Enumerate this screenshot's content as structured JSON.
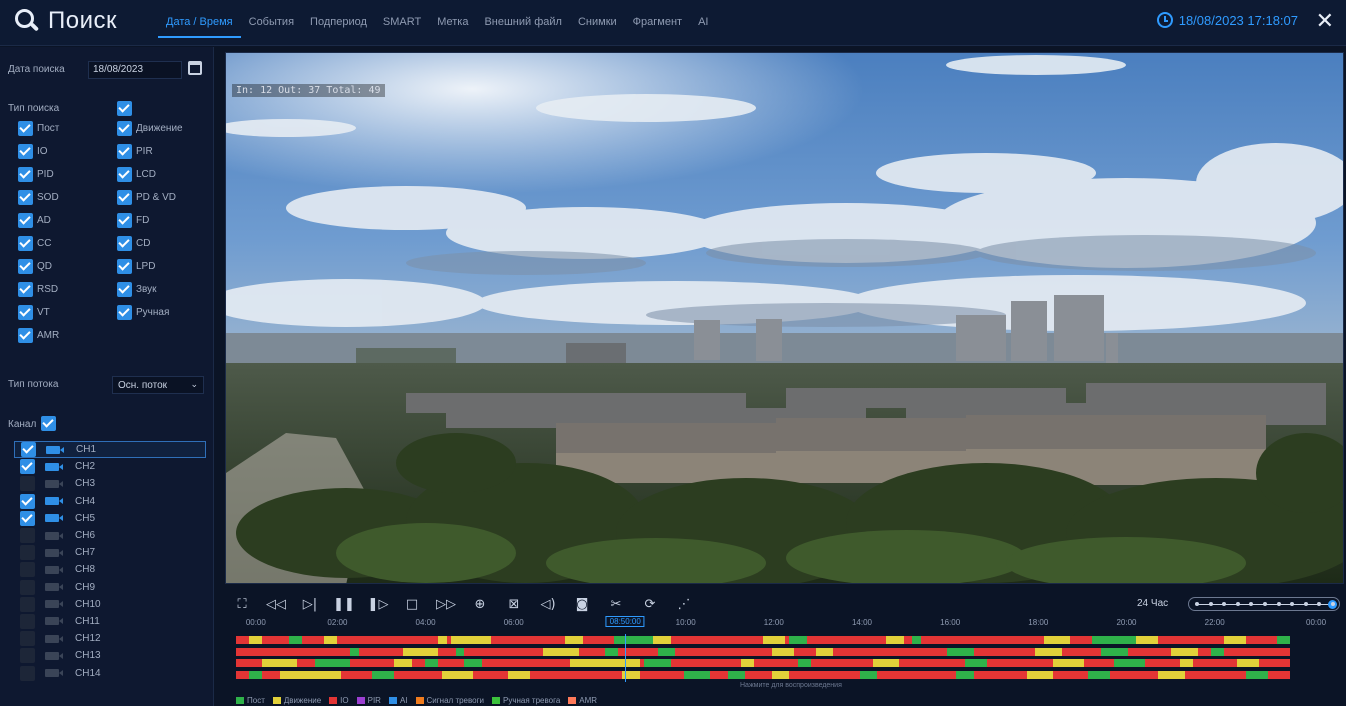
{
  "header": {
    "title": "Поиск",
    "tabs": [
      {
        "label": "Дата / Время",
        "active": true
      },
      {
        "label": "События",
        "active": false
      },
      {
        "label": "Подпериод",
        "active": false
      },
      {
        "label": "SMART",
        "active": false
      },
      {
        "label": "Метка",
        "active": false
      },
      {
        "label": "Внешний файл",
        "active": false
      },
      {
        "label": "Снимки",
        "active": false
      },
      {
        "label": "Фрагмент",
        "active": false
      },
      {
        "label": "AI",
        "active": false
      }
    ],
    "datetime": "18/08/2023 17:18:07",
    "accent_color": "#2f9bff"
  },
  "sidebar": {
    "search_date_label": "Дата поиска",
    "search_date_value": "18/08/2023",
    "search_type_label": "Тип поиска",
    "search_type_all": true,
    "types": [
      {
        "label": "Пост",
        "checked": true
      },
      {
        "label": "Движение",
        "checked": true
      },
      {
        "label": "IO",
        "checked": true
      },
      {
        "label": "PIR",
        "checked": true
      },
      {
        "label": "PID",
        "checked": true
      },
      {
        "label": "LCD",
        "checked": true
      },
      {
        "label": "SOD",
        "checked": true
      },
      {
        "label": "PD & VD",
        "checked": true
      },
      {
        "label": "AD",
        "checked": true
      },
      {
        "label": "FD",
        "checked": true
      },
      {
        "label": "CC",
        "checked": true
      },
      {
        "label": "CD",
        "checked": true
      },
      {
        "label": "QD",
        "checked": true
      },
      {
        "label": "LPD",
        "checked": true
      },
      {
        "label": "RSD",
        "checked": true
      },
      {
        "label": "Звук",
        "checked": true
      },
      {
        "label": "VT",
        "checked": true
      },
      {
        "label": "Ручная",
        "checked": true
      },
      {
        "label": "AMR",
        "checked": true
      }
    ],
    "stream_type_label": "Тип потока",
    "stream_type_value": "Осн. поток",
    "channels_label": "Канал",
    "channels_all": true,
    "channels": [
      {
        "label": "CH1",
        "checked": true,
        "active": true,
        "selected": true
      },
      {
        "label": "CH2",
        "checked": true,
        "active": true,
        "selected": false
      },
      {
        "label": "CH3",
        "checked": false,
        "active": false,
        "selected": false
      },
      {
        "label": "CH4",
        "checked": true,
        "active": true,
        "selected": false
      },
      {
        "label": "CH5",
        "checked": true,
        "active": true,
        "selected": false
      },
      {
        "label": "CH6",
        "checked": false,
        "active": false,
        "selected": false
      },
      {
        "label": "CH7",
        "checked": false,
        "active": false,
        "selected": false
      },
      {
        "label": "CH8",
        "checked": false,
        "active": false,
        "selected": false
      },
      {
        "label": "CH9",
        "checked": false,
        "active": false,
        "selected": false
      },
      {
        "label": "CH10",
        "checked": false,
        "active": false,
        "selected": false
      },
      {
        "label": "CH11",
        "checked": false,
        "active": false,
        "selected": false
      },
      {
        "label": "CH12",
        "checked": false,
        "active": false,
        "selected": false
      },
      {
        "label": "CH13",
        "checked": false,
        "active": false,
        "selected": false
      },
      {
        "label": "CH14",
        "checked": false,
        "active": false,
        "selected": false
      }
    ]
  },
  "video": {
    "osd_text": "In: 12  Out: 37  Total: 49"
  },
  "controls": [
    {
      "name": "fullscreen-icon",
      "glyph": "⛶"
    },
    {
      "name": "rewind-icon",
      "glyph": "◁◁"
    },
    {
      "name": "slow-play-icon",
      "glyph": "▷|"
    },
    {
      "name": "pause-icon",
      "glyph": "❚❚"
    },
    {
      "name": "frame-step-icon",
      "glyph": "❚▷"
    },
    {
      "name": "stop-icon",
      "glyph": "□"
    },
    {
      "name": "fast-forward-icon",
      "glyph": "▷▷"
    },
    {
      "name": "zoom-icon",
      "glyph": "⊕"
    },
    {
      "name": "split-screen-icon",
      "glyph": "⊠"
    },
    {
      "name": "volume-icon",
      "glyph": "◁)"
    },
    {
      "name": "snapshot-icon",
      "glyph": "◙"
    },
    {
      "name": "clip-icon",
      "glyph": "✂"
    },
    {
      "name": "save-icon",
      "glyph": "⟳"
    },
    {
      "name": "tag-icon",
      "glyph": "⋰"
    }
  ],
  "zoom": {
    "label": "24 Час",
    "level": 1.0
  },
  "timeline": {
    "ticks": [
      "00:00",
      "02:00",
      "04:00",
      "06:00",
      "10:00",
      "12:00",
      "14:00",
      "16:00",
      "18:00",
      "20:00",
      "22:00",
      "00:00"
    ],
    "cursor_time": "08:50:00",
    "cursor_hour": 8.83,
    "hint": "Нажмите для воспроизведения",
    "tracks": [
      {
        "channel": "CH1",
        "segments": [
          [
            0.3,
            0.6,
            "yellow"
          ],
          [
            1.2,
            1.5,
            "green"
          ],
          [
            2.0,
            2.3,
            "yellow"
          ],
          [
            4.6,
            4.8,
            "yellow"
          ],
          [
            4.9,
            5.8,
            "yellow"
          ],
          [
            7.5,
            7.9,
            "yellow"
          ],
          [
            8.6,
            9.5,
            "green"
          ],
          [
            9.5,
            9.9,
            "yellow"
          ],
          [
            12.0,
            12.5,
            "yellow"
          ],
          [
            12.6,
            13.0,
            "green"
          ],
          [
            14.8,
            15.2,
            "yellow"
          ],
          [
            15.4,
            15.6,
            "green"
          ],
          [
            18.4,
            19.0,
            "yellow"
          ],
          [
            19.5,
            20.5,
            "green"
          ],
          [
            20.5,
            21.0,
            "yellow"
          ],
          [
            22.5,
            23.0,
            "yellow"
          ],
          [
            23.7,
            24.0,
            "green"
          ]
        ]
      },
      {
        "channel": "CH2",
        "segments": [
          [
            2.6,
            2.8,
            "green"
          ],
          [
            3.8,
            4.6,
            "yellow"
          ],
          [
            5.0,
            5.2,
            "green"
          ],
          [
            7.0,
            7.8,
            "yellow"
          ],
          [
            8.4,
            8.7,
            "green"
          ],
          [
            9.6,
            10.0,
            "green"
          ],
          [
            12.2,
            12.7,
            "yellow"
          ],
          [
            13.2,
            13.6,
            "yellow"
          ],
          [
            16.2,
            16.8,
            "green"
          ],
          [
            18.2,
            18.8,
            "yellow"
          ],
          [
            19.7,
            20.3,
            "green"
          ],
          [
            21.3,
            21.9,
            "yellow"
          ],
          [
            22.2,
            22.5,
            "green"
          ]
        ]
      },
      {
        "channel": "CH4",
        "segments": [
          [
            0.6,
            1.4,
            "yellow"
          ],
          [
            1.8,
            2.6,
            "green"
          ],
          [
            3.6,
            4.0,
            "yellow"
          ],
          [
            4.3,
            4.6,
            "green"
          ],
          [
            5.2,
            5.6,
            "green"
          ],
          [
            7.6,
            9.2,
            "yellow"
          ],
          [
            9.3,
            9.9,
            "green"
          ],
          [
            11.5,
            11.8,
            "yellow"
          ],
          [
            12.8,
            13.1,
            "green"
          ],
          [
            14.5,
            15.1,
            "yellow"
          ],
          [
            16.6,
            17.1,
            "green"
          ],
          [
            18.6,
            19.3,
            "yellow"
          ],
          [
            20.0,
            20.7,
            "green"
          ],
          [
            21.5,
            21.8,
            "yellow"
          ],
          [
            22.8,
            23.3,
            "yellow"
          ]
        ]
      },
      {
        "channel": "CH5",
        "segments": [
          [
            0.3,
            0.6,
            "green"
          ],
          [
            1.0,
            2.4,
            "yellow"
          ],
          [
            3.1,
            3.6,
            "green"
          ],
          [
            4.7,
            5.4,
            "yellow"
          ],
          [
            6.2,
            6.7,
            "yellow"
          ],
          [
            8.8,
            9.2,
            "yellow"
          ],
          [
            10.2,
            10.8,
            "green"
          ],
          [
            11.2,
            11.6,
            "green"
          ],
          [
            12.2,
            12.6,
            "yellow"
          ],
          [
            14.2,
            14.6,
            "green"
          ],
          [
            16.4,
            16.8,
            "green"
          ],
          [
            18.0,
            18.6,
            "yellow"
          ],
          [
            19.4,
            19.9,
            "green"
          ],
          [
            21.0,
            21.6,
            "yellow"
          ],
          [
            23.0,
            23.5,
            "green"
          ]
        ]
      }
    ]
  },
  "legend": [
    {
      "label": "Пост",
      "color": "#2fb24a"
    },
    {
      "label": "Движение",
      "color": "#e2d13a"
    },
    {
      "label": "IO",
      "color": "#e33535"
    },
    {
      "label": "PIR",
      "color": "#9b3fd1"
    },
    {
      "label": "AI",
      "color": "#2f8fe6"
    },
    {
      "label": "Сигнал тревоги",
      "color": "#f07c1e"
    },
    {
      "label": "Ручная тревога",
      "color": "#3cc23c"
    },
    {
      "label": "AMR",
      "color": "#ff7a5a"
    }
  ],
  "colors": {
    "green": "#2fb24a",
    "yellow": "#e2d13a",
    "red": "#e33535"
  }
}
